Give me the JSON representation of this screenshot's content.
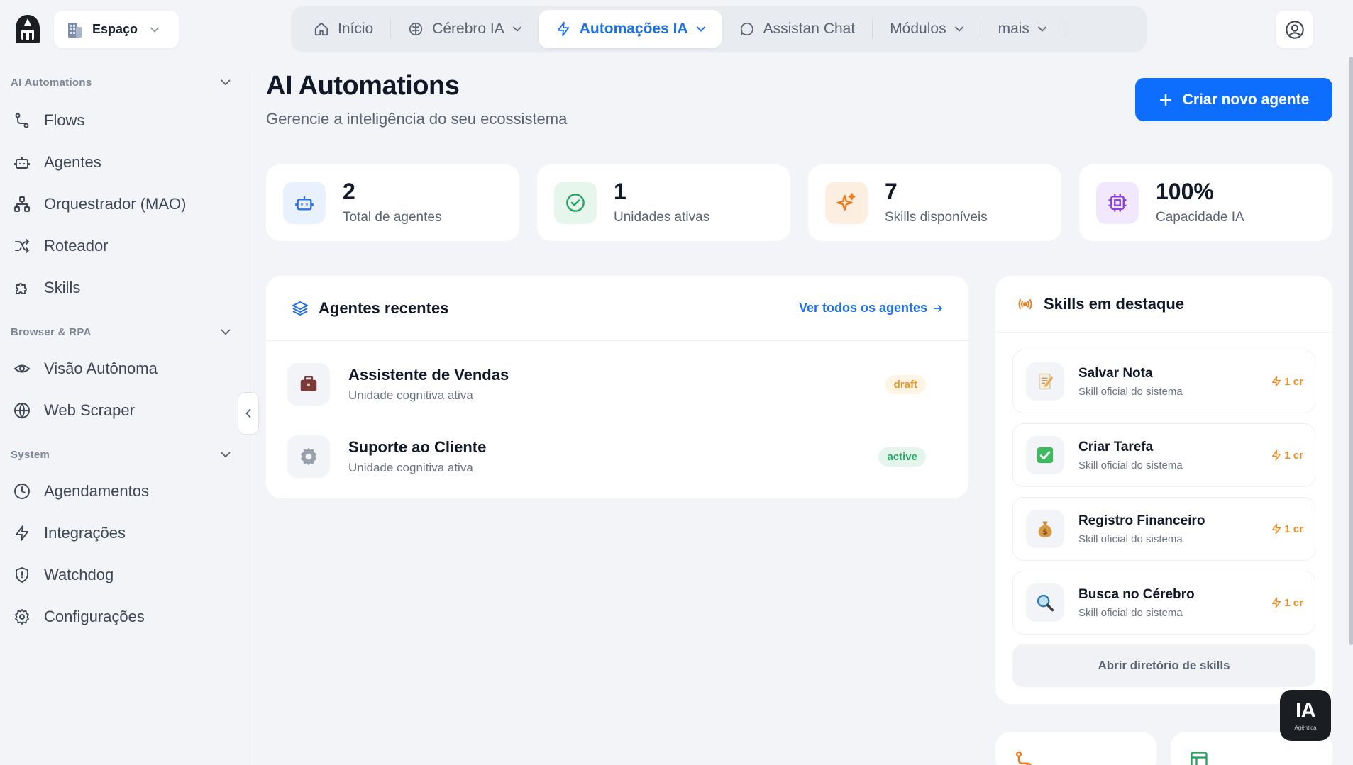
{
  "topbar": {
    "space_label": "Espaço",
    "nav": [
      {
        "label": "Início",
        "icon": "home-icon"
      },
      {
        "label": "Cérebro IA",
        "icon": "brain-icon",
        "dropdown": true
      },
      {
        "label": "Automações IA",
        "icon": "lightning-icon",
        "dropdown": true,
        "active": true
      },
      {
        "label": "Assistan Chat",
        "icon": "chat-bubble-icon"
      },
      {
        "label": "Módulos",
        "dropdown": true
      },
      {
        "label": "mais",
        "dropdown": true
      }
    ]
  },
  "sidebar": {
    "sections": [
      {
        "title": "AI Automations",
        "items": [
          {
            "label": "Flows",
            "icon": "flow-icon"
          },
          {
            "label": "Agentes",
            "icon": "robot-icon"
          },
          {
            "label": "Orquestrador (MAO)",
            "icon": "hierarchy-icon"
          },
          {
            "label": "Roteador",
            "icon": "shuffle-icon"
          },
          {
            "label": "Skills",
            "icon": "puzzle-icon"
          }
        ]
      },
      {
        "title": "Browser & RPA",
        "items": [
          {
            "label": "Visão Autônoma",
            "icon": "eye-icon"
          },
          {
            "label": "Web Scraper",
            "icon": "globe-icon"
          }
        ]
      },
      {
        "title": "System",
        "items": [
          {
            "label": "Agendamentos",
            "icon": "clock-icon"
          },
          {
            "label": "Integrações",
            "icon": "lightning-icon"
          },
          {
            "label": "Watchdog",
            "icon": "shield-icon"
          },
          {
            "label": "Configurações",
            "icon": "gear-icon"
          }
        ]
      }
    ]
  },
  "header": {
    "title": "AI Automations",
    "subtitle": "Gerencie a inteligência do seu ecossistema",
    "create_button": "Criar novo agente"
  },
  "stats": [
    {
      "value": "2",
      "label": "Total de agentes",
      "icon": "robot-icon",
      "color": "#2a73e8",
      "bg": "#e8f1fd"
    },
    {
      "value": "1",
      "label": "Unidades ativas",
      "icon": "check-circle-icon",
      "color": "#22a45d",
      "bg": "#e6f6ed"
    },
    {
      "value": "7",
      "label": "Skills disponíveis",
      "icon": "sparkles-icon",
      "color": "#f07a1a",
      "bg": "#fdeee2"
    },
    {
      "value": "100%",
      "label": "Capacidade IA",
      "icon": "cpu-icon",
      "color": "#8b3fe0",
      "bg": "#f1e8fd"
    }
  ],
  "agents": {
    "title": "Agentes recentes",
    "view_all": "Ver todos os agentes",
    "items": [
      {
        "name": "Assistente de Vendas",
        "description": "Unidade cognitiva ativa",
        "status": "draft",
        "icon": "briefcase-icon"
      },
      {
        "name": "Suporte ao Cliente",
        "description": "Unidade cognitiva ativa",
        "status": "active",
        "icon": "gear-icon"
      }
    ]
  },
  "skills": {
    "title": "Skills em destaque",
    "items": [
      {
        "name": "Salvar Nota",
        "description": "Skill oficial do sistema",
        "cost": "1 cr",
        "icon": "memo-icon"
      },
      {
        "name": "Criar Tarefa",
        "description": "Skill oficial do sistema",
        "cost": "1 cr",
        "icon": "check-box-icon"
      },
      {
        "name": "Registro Financeiro",
        "description": "Skill oficial do sistema",
        "cost": "1 cr",
        "icon": "money-bag-icon"
      },
      {
        "name": "Busca no Cérebro",
        "description": "Skill oficial do sistema",
        "cost": "1 cr",
        "icon": "magnifier-icon"
      }
    ],
    "open_directory": "Abrir diretório de skills"
  },
  "floating_logo": {
    "text": "IA",
    "subtext": "Agêntica"
  },
  "colors": {
    "accent": "#0d6efd",
    "orange": "#f08c1f"
  }
}
